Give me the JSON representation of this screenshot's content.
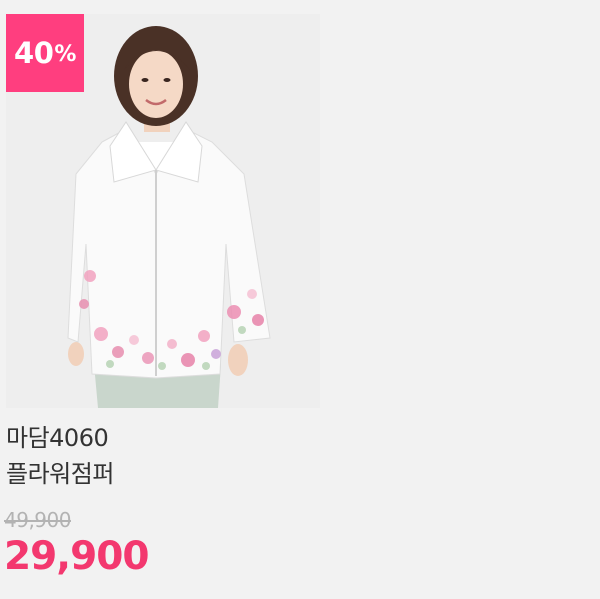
{
  "product": {
    "discount": {
      "value": "40",
      "unit": "%"
    },
    "brand": "마담4060",
    "name": "플라워점퍼",
    "original_price": "49,900",
    "sale_price": "29,900",
    "colors": {
      "badge": "#ff3e7f",
      "sale_price": "#f3386f",
      "background": "#f2f2f2"
    }
  }
}
